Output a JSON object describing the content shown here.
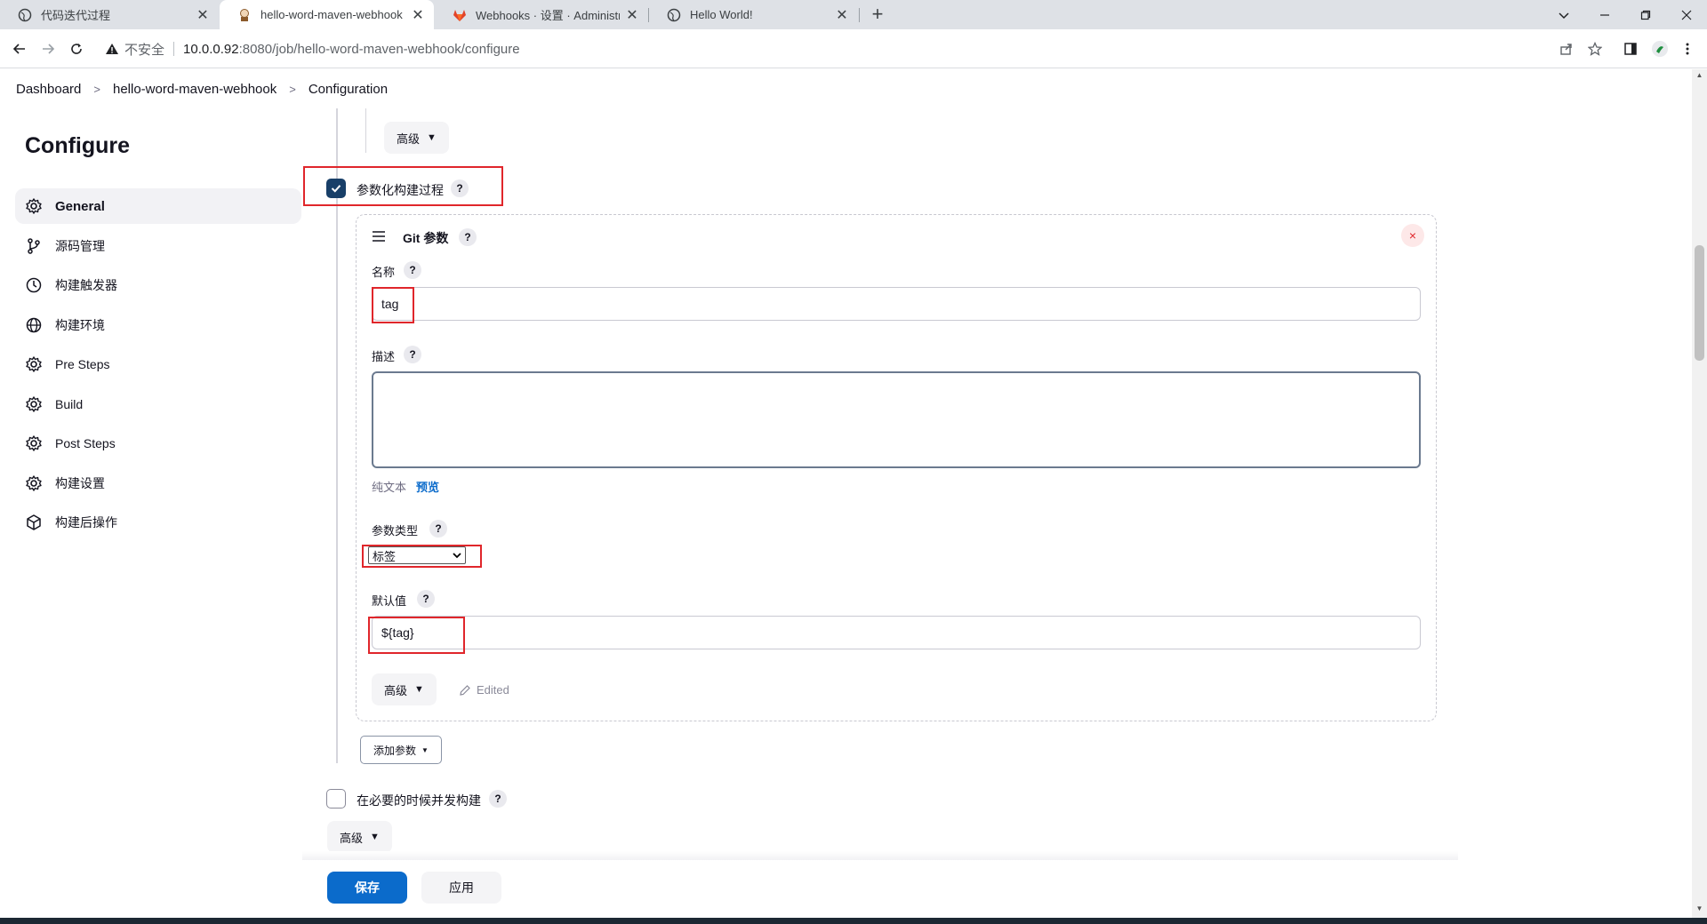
{
  "browser": {
    "tabs": [
      {
        "title": "代码迭代过程",
        "active": false
      },
      {
        "title": "hello-word-maven-webhook Config",
        "active": true
      },
      {
        "title": "Webhooks · 设置 · Administrator",
        "active": false
      },
      {
        "title": "Hello World!",
        "active": false
      }
    ],
    "new_tab": "+",
    "address": {
      "security_label": "不安全",
      "host": "10.0.0.92",
      "path": ":8080/job/hello-word-maven-webhook/configure"
    }
  },
  "breadcrumb": {
    "items": [
      "Dashboard",
      "hello-word-maven-webhook",
      "Configuration"
    ]
  },
  "sidebar": {
    "title": "Configure",
    "items": [
      {
        "label": "General",
        "icon": "gear-icon",
        "active": true
      },
      {
        "label": "源码管理",
        "icon": "branch-icon",
        "active": false
      },
      {
        "label": "构建触发器",
        "icon": "clock-icon",
        "active": false
      },
      {
        "label": "构建环境",
        "icon": "globe-icon",
        "active": false
      },
      {
        "label": "Pre Steps",
        "icon": "gear-icon",
        "active": false
      },
      {
        "label": "Build",
        "icon": "gear-icon",
        "active": false
      },
      {
        "label": "Post Steps",
        "icon": "gear-icon",
        "active": false
      },
      {
        "label": "构建设置",
        "icon": "gear-icon",
        "active": false
      },
      {
        "label": "构建后操作",
        "icon": "cube-icon",
        "active": false
      }
    ]
  },
  "main": {
    "advanced_label": "高级",
    "parameterized": {
      "label": "参数化构建过程",
      "checked": true,
      "help": "?"
    },
    "git_param": {
      "title": "Git 参数",
      "close": "×",
      "name_label": "名称",
      "name_value": "tag",
      "desc_label": "描述",
      "desc_value": "",
      "plain_text": "纯文本",
      "preview": "预览",
      "type_label": "参数类型",
      "type_value": "标签",
      "default_label": "默认值",
      "default_value": "${tag}",
      "advanced_label": "高级",
      "edited": "Edited"
    },
    "add_param": "添加参数",
    "concurrent": {
      "label": "在必要的时候并发构建",
      "checked": false
    },
    "advanced_bottom": "高级",
    "save": "保存",
    "apply": "应用"
  },
  "colors": {
    "accent": "#0b6bcb",
    "checkbox": "#183f68",
    "highlight_box": "#e0262b"
  }
}
